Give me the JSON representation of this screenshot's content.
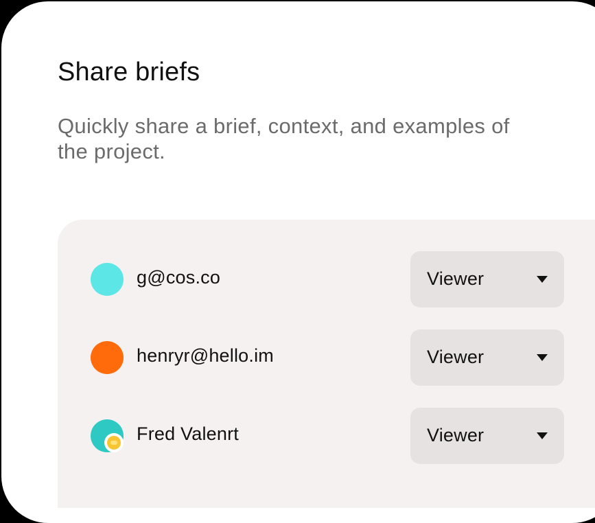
{
  "header": {
    "title": "Share briefs",
    "subtitle": "Quickly share a brief, context, and examples of the project."
  },
  "members": [
    {
      "name": "g@cos.co",
      "role": "Viewer",
      "avatar_color": "#5ce6e6"
    },
    {
      "name": "henryr@hello.im",
      "role": "Viewer",
      "avatar_color": "#ff6b0a"
    },
    {
      "name": "Fred Valenrt",
      "role": "Viewer",
      "avatar_color": "#2ec9c3",
      "badge": "coin-icon"
    }
  ],
  "colors": {
    "panel": "#f5f1f1",
    "select": "#e6e2e2"
  }
}
